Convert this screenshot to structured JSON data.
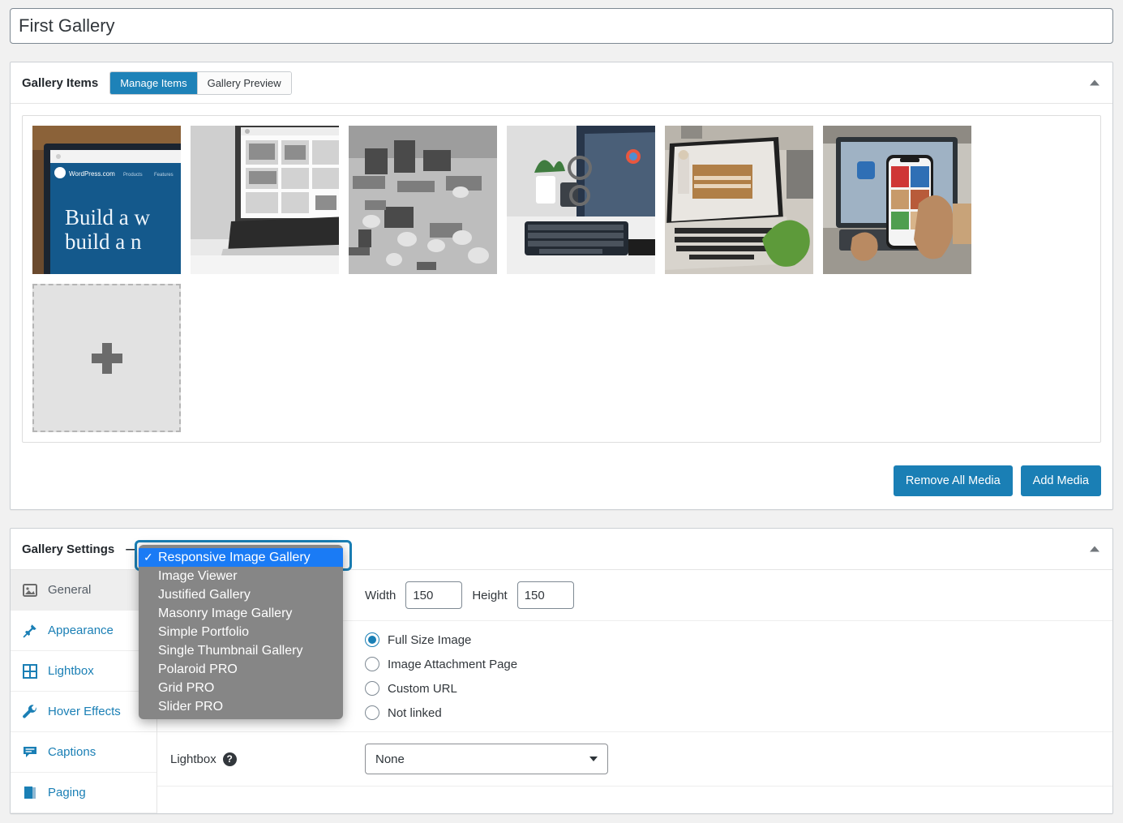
{
  "title_field": {
    "value": "First Gallery"
  },
  "gallery_items": {
    "heading": "Gallery Items",
    "tabs": [
      {
        "label": "Manage Items",
        "active": true
      },
      {
        "label": "Gallery Preview",
        "active": false
      }
    ],
    "collapse_icon": "caret-up-icon",
    "thumbnails": [
      {
        "alt": "laptop showing WordPress.com build a website page",
        "headline": "Build a w",
        "subline": "build a n",
        "brand": "WordPress.com"
      },
      {
        "alt": "black and white laptop on desk showing photo grid"
      },
      {
        "alt": "black and white circuit board close up"
      },
      {
        "alt": "desktop monitor with keyboard and potted plants"
      },
      {
        "alt": "laptop on table showing interior photo"
      },
      {
        "alt": "hand holding smartphone in front of laptop"
      }
    ],
    "add_tile_label": "+",
    "buttons": {
      "remove_all": "Remove All Media",
      "add_media": "Add Media"
    }
  },
  "gallery_settings": {
    "heading": "Gallery Settings",
    "heading_separator": "—",
    "collapse_icon": "caret-up-icon",
    "layout_select": {
      "value": "Responsive Image Gallery"
    },
    "nav": [
      {
        "label": "General",
        "icon": "image-icon",
        "active": true
      },
      {
        "label": "Appearance",
        "icon": "pin-icon",
        "active": false
      },
      {
        "label": "Lightbox",
        "icon": "grid-icon",
        "active": false
      },
      {
        "label": "Hover Effects",
        "icon": "wrench-icon",
        "active": false
      },
      {
        "label": "Captions",
        "icon": "comment-icon",
        "active": false
      },
      {
        "label": "Paging",
        "icon": "book-icon",
        "active": false
      }
    ],
    "size_row": {
      "width_label": "Width",
      "width_value": "150",
      "height_label": "Height",
      "height_value": "150"
    },
    "link_to": {
      "options": [
        {
          "label": "Full Size Image",
          "selected": true
        },
        {
          "label": "Image Attachment Page",
          "selected": false
        },
        {
          "label": "Custom URL",
          "selected": false
        },
        {
          "label": "Not linked",
          "selected": false
        }
      ]
    },
    "lightbox_row": {
      "label": "Lightbox",
      "help_icon": "question-mark-icon",
      "help_glyph": "?",
      "value": "None"
    }
  },
  "dropdown": {
    "check_glyph": "✓",
    "options": [
      {
        "label": "Responsive Image Gallery",
        "selected": true
      },
      {
        "label": "Image Viewer",
        "selected": false
      },
      {
        "label": "Justified Gallery",
        "selected": false
      },
      {
        "label": "Masonry Image Gallery",
        "selected": false
      },
      {
        "label": "Simple Portfolio",
        "selected": false
      },
      {
        "label": "Single Thumbnail Gallery",
        "selected": false
      },
      {
        "label": "Polaroid PRO",
        "selected": false
      },
      {
        "label": "Grid PRO",
        "selected": false
      },
      {
        "label": "Slider PRO",
        "selected": false
      }
    ]
  },
  "colors": {
    "accent": "#1a7fb5",
    "tab_active": "#1e82b8",
    "menu_bg": "#868686",
    "menu_highlight": "#1a7bf5",
    "page_bg": "#f1f1f1"
  }
}
